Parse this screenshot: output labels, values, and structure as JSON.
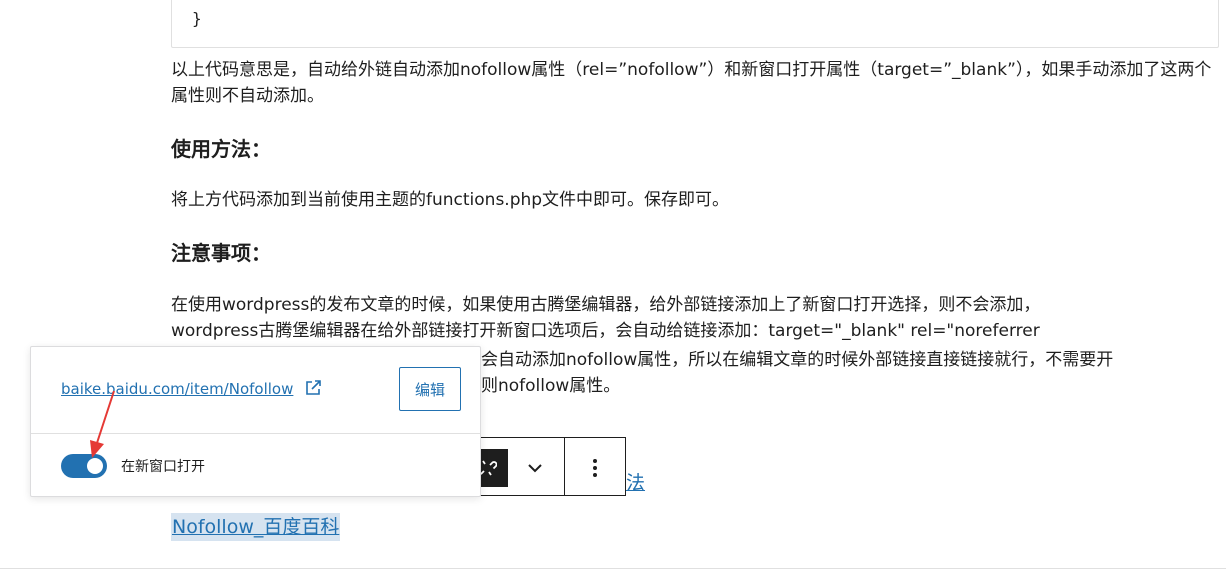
{
  "code": {
    "closing_brace": "}"
  },
  "content": {
    "para1": "以上代码意思是，自动给外链自动添加nofollow属性（rel=”nofollow”）和新窗口打开属性（target=”_blank”），如果手动添加了这两个属性则不自动添加。",
    "heading_usage": "使用方法：",
    "para_usage": "将上方代码添加到当前使用主题的functions.php文件中即可。保存即可。",
    "heading_notes": "注意事项：",
    "notes_line1": "在使用wordpress的发布文章的时候，如果使用古腾堡编辑器，给外部链接添加上了新窗口打开选择，则不会添加，",
    "notes_line2": "wordpress古腾堡编辑器在给外部链接打开新窗口选项后，会自动给链接添加：target=\"_blank\" rel=\"noreferrer",
    "notes_line3_visible": "会自动添加nofollow属性，所以在编辑文章的时候外部链接直接链接就行，不需要开",
    "notes_line4_visible": "则nofollow属性。",
    "link_partial": "法",
    "selected_link": "Nofollow_百度百科"
  },
  "popover": {
    "url": "baike.baidu.com/item/Nofollow",
    "edit_label": "编辑",
    "toggle_label": "在新窗口打开",
    "toggle_on": true
  },
  "toolbar": {
    "unlink_icon": "unlink-icon",
    "chevron_icon": "chevron-down-icon",
    "more_icon": "more-vertical-icon"
  },
  "colors": {
    "accent": "#2271b1",
    "annotation_arrow": "#e53935",
    "selection_bg": "#d6e3f0"
  }
}
